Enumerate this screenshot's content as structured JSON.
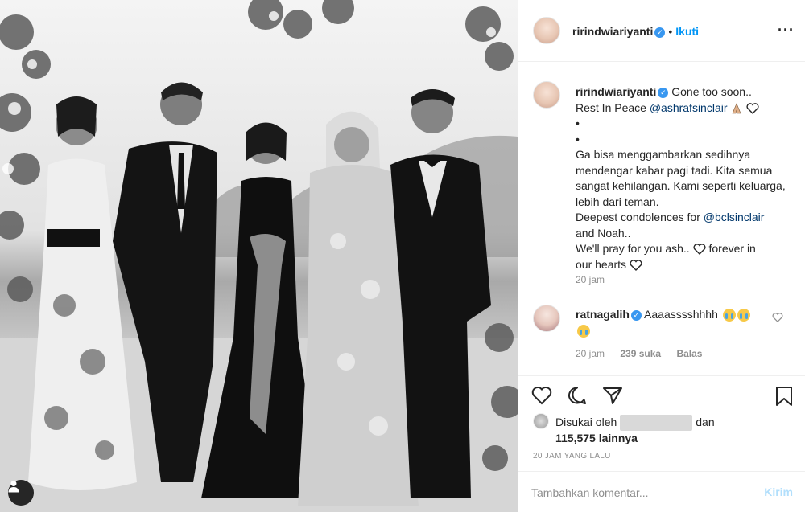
{
  "post": {
    "username": "ririndwiariyanti",
    "follow_label": "Ikuti",
    "more_icon": "more-options-icon"
  },
  "caption": {
    "username": "ririndwiariyanti",
    "line1": "Gone too soon..",
    "line2_prefix": "Rest In Peace",
    "mention1": "@ashrafsinclair",
    "bullet1": "•",
    "bullet2": "•",
    "para1": "Ga bisa menggambarkan sedihnya mendengar kabar pagi tadi. Kita semua sangat kehilangan. Kami seperti keluarga, lebih dari teman.",
    "condolence_prefix": "Deepest condolences for",
    "mention2": "@bclsinclair",
    "condolence_suffix": "and Noah..",
    "pray_prefix": "We'll pray for you ash..",
    "pray_mid": "forever in",
    "pray_end": "our hearts",
    "time": "20 jam"
  },
  "comment": {
    "username": "ratnagalih",
    "text": "Aaaasssshhhh",
    "time": "20 jam",
    "likes": "239 suka",
    "reply": "Balas"
  },
  "likes": {
    "prefix": "Disukai oleh",
    "mid": "dan",
    "count": "115,575 lainnya"
  },
  "post_time": "20 JAM YANG LALU",
  "add_comment": {
    "placeholder": "Tambahkan komentar...",
    "post_label": "Kirim"
  },
  "colors": {
    "accent": "#0095f6",
    "verified": "#3897f0",
    "mention": "#00376b",
    "muted": "#8e8e8e"
  }
}
